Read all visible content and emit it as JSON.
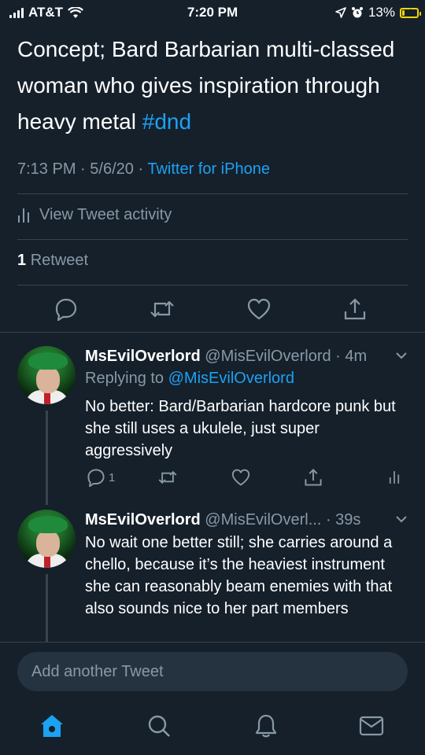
{
  "status_bar": {
    "carrier": "AT&T",
    "time": "7:20 PM",
    "battery": "13%",
    "battery_level": 0.13
  },
  "tweet": {
    "text": "Concept; Bard Barbarian multi-classed woman who gives inspiration through heavy metal",
    "hashtag": "#dnd",
    "time": "7:13 PM",
    "date": "5/6/20",
    "separator": "·",
    "source": "Twitter for iPhone",
    "activity_label": "View Tweet activity",
    "retweet_count": "1",
    "retweet_label": "Retweet"
  },
  "replies": [
    {
      "name": "MsEvilOverlord",
      "handle": "@MisEvilOverlord",
      "time": "· 4m",
      "replying_label": "Replying to",
      "replying_to": "@MisEvilOverlord",
      "text": "No better: Bard/Barbarian hardcore punk but she still uses a ukulele, just super aggressively",
      "reply_count": "1"
    },
    {
      "name": "MsEvilOverlord",
      "handle": "@MisEvilOverl...",
      "time": "· 39s",
      "text": "No wait one better still; she carries around a chello, because it’s the heaviest instrument she can reasonably beam enemies with that also sounds nice to her part members"
    }
  ],
  "compose": {
    "placeholder": "Add another Tweet"
  },
  "colors": {
    "background": "#15202b",
    "accent": "#1da1f2",
    "muted": "#8899a6",
    "divider": "#38444d"
  }
}
